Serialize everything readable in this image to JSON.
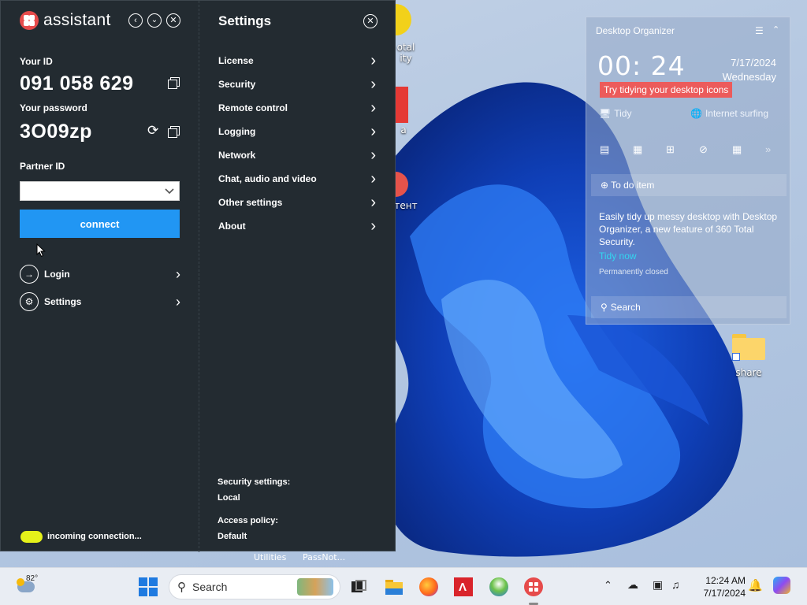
{
  "assistant": {
    "brand": "assistant",
    "your_id_label": "Your ID",
    "your_id": "091 058 629",
    "password_label": "Your password",
    "password": "3O09zp",
    "partner_id_label": "Partner ID",
    "partner_id_value": "",
    "connect_label": "connect",
    "side_items": [
      {
        "label": "Login",
        "icon": "login-icon"
      },
      {
        "label": "Settings",
        "icon": "settings-icon"
      }
    ],
    "status_text": "incoming connection...",
    "status_color": "#e6f21a"
  },
  "settings": {
    "title": "Settings",
    "items": [
      "License",
      "Security",
      "Remote control",
      "Logging",
      "Network",
      "Chat, audio and video",
      "Other settings",
      "About"
    ],
    "security_settings_label": "Security settings:",
    "security_settings_value": "Local",
    "access_policy_label": "Access policy:",
    "access_policy_value": "Default"
  },
  "organizer": {
    "title": "Desktop Organizer",
    "time": "00: 24",
    "date": "7/17/2024",
    "day": "Wednesday",
    "tip": "Try tidying your desktop icons",
    "tidy_label": "Tidy",
    "internet_label": "Internet surfing",
    "todo_placeholder": "To do item",
    "description": "Easily tidy up messy desktop with Desktop Organizer, a new feature of 360 Total Security.",
    "tidy_link": "Tidy now",
    "closed_text": "Permanently closed",
    "search_placeholder": "Search",
    "tip_color": "#ec5b5b",
    "link_color": "#33d6f0"
  },
  "desktop": {
    "icons": [
      {
        "label": "share",
        "icon": "folder-icon"
      },
      {
        "label": "Total\nrity",
        "icon": "360-icon"
      },
      {
        "label": "a",
        "icon": "app-icon"
      },
      {
        "label": "тент",
        "icon": "app-icon"
      }
    ],
    "behind_labels": [
      "Utilities",
      "PassNot..."
    ]
  },
  "taskbar": {
    "temperature": "82°",
    "search_placeholder": "Search",
    "clock_time": "12:24 AM",
    "clock_date": "7/17/2024"
  }
}
